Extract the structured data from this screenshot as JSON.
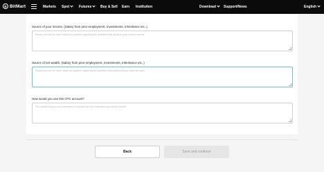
{
  "header": {
    "logo_text": "BitMart",
    "nav": [
      {
        "label": "Markets"
      },
      {
        "label": "Spot"
      },
      {
        "label": "Futures"
      },
      {
        "label": "Buy & Sell"
      },
      {
        "label": "Earn"
      },
      {
        "label": "Institution"
      }
    ],
    "download_label": "Download",
    "support_label": "Support/News",
    "language_label": "English"
  },
  "form": {
    "fields": [
      {
        "label": "Source of your income. (Salary from prior employment, Investments, Inheritance etc..)",
        "placeholder": "Please provide as much detail as possible regarding the activities that produce your current income"
      },
      {
        "label": "Source of net wealth. (Salary from prior employment, Investments, Inheritance etc..)",
        "placeholder": "Please provide as much detail as possible regarding the activities that produced your total net worth"
      },
      {
        "label": "How would you use this OTC account?",
        "placeholder": "The assets that you are interested in buy/sell and the estimated amount per month"
      }
    ]
  },
  "actions": {
    "back_label": "Back",
    "save_label": "Save and continue"
  }
}
